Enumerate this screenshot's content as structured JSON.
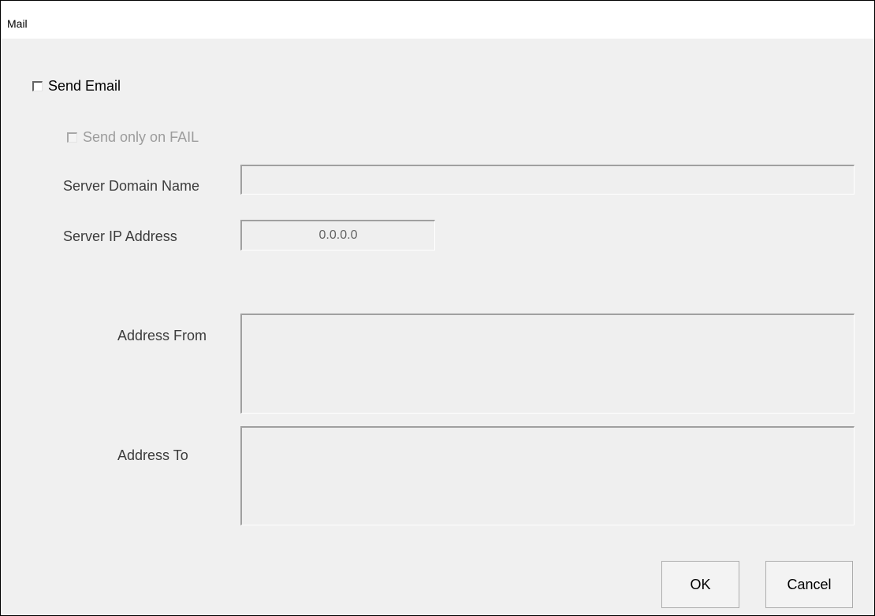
{
  "window": {
    "title": "Mail"
  },
  "send_email": {
    "label": "Send Email",
    "checked": false
  },
  "send_only_on_fail": {
    "label": "Send only on FAIL",
    "checked": false,
    "enabled": false
  },
  "server_domain_name": {
    "label": "Server Domain Name",
    "value": ""
  },
  "server_ip_address": {
    "label": "Server IP Address",
    "value": "0.0.0.0"
  },
  "address_from": {
    "label": "Address From",
    "value": ""
  },
  "address_to": {
    "label": "Address To",
    "value": ""
  },
  "buttons": {
    "ok": "OK",
    "cancel": "Cancel"
  }
}
